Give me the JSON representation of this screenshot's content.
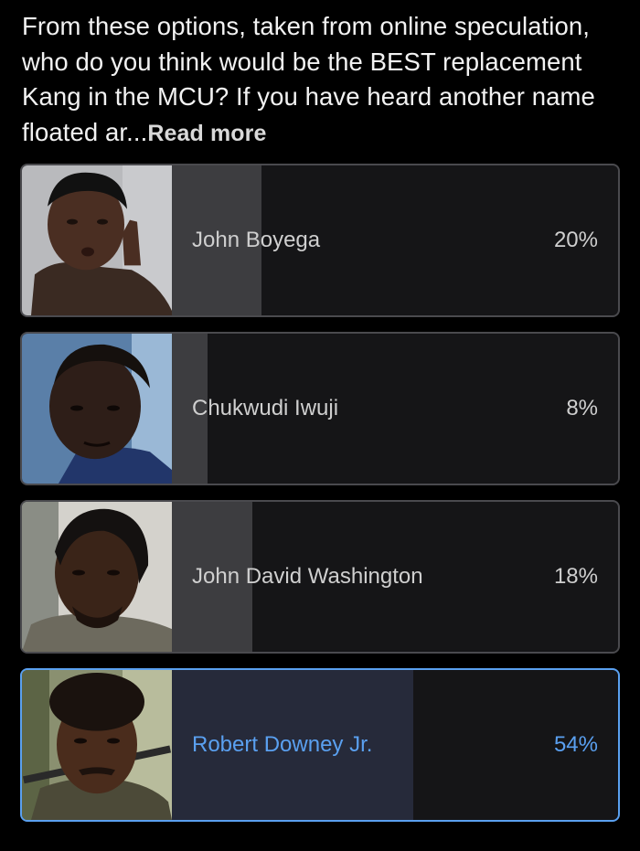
{
  "poll": {
    "question": "From these options, taken from online speculation, who do you think would be the BEST replacement Kang in the MCU? If you have heard another name floated ar...",
    "read_more_label": "Read more",
    "options": [
      {
        "label": "John Boyega",
        "percent_label": "20%",
        "percent": 20,
        "selected": false,
        "photo_icon": "portrait-john-boyega"
      },
      {
        "label": "Chukwudi Iwuji",
        "percent_label": "8%",
        "percent": 8,
        "selected": false,
        "photo_icon": "portrait-chukwudi-iwuji"
      },
      {
        "label": "John David Washington",
        "percent_label": "18%",
        "percent": 18,
        "selected": false,
        "photo_icon": "portrait-john-david-washington"
      },
      {
        "label": "Robert Downey Jr.",
        "percent_label": "54%",
        "percent": 54,
        "selected": true,
        "photo_icon": "portrait-robert-downey-jr"
      }
    ]
  },
  "colors": {
    "background": "#000000",
    "bar_fill": "#3d3d40",
    "selected_accent": "#5aa0f0",
    "selected_fill": "#262a3a"
  }
}
